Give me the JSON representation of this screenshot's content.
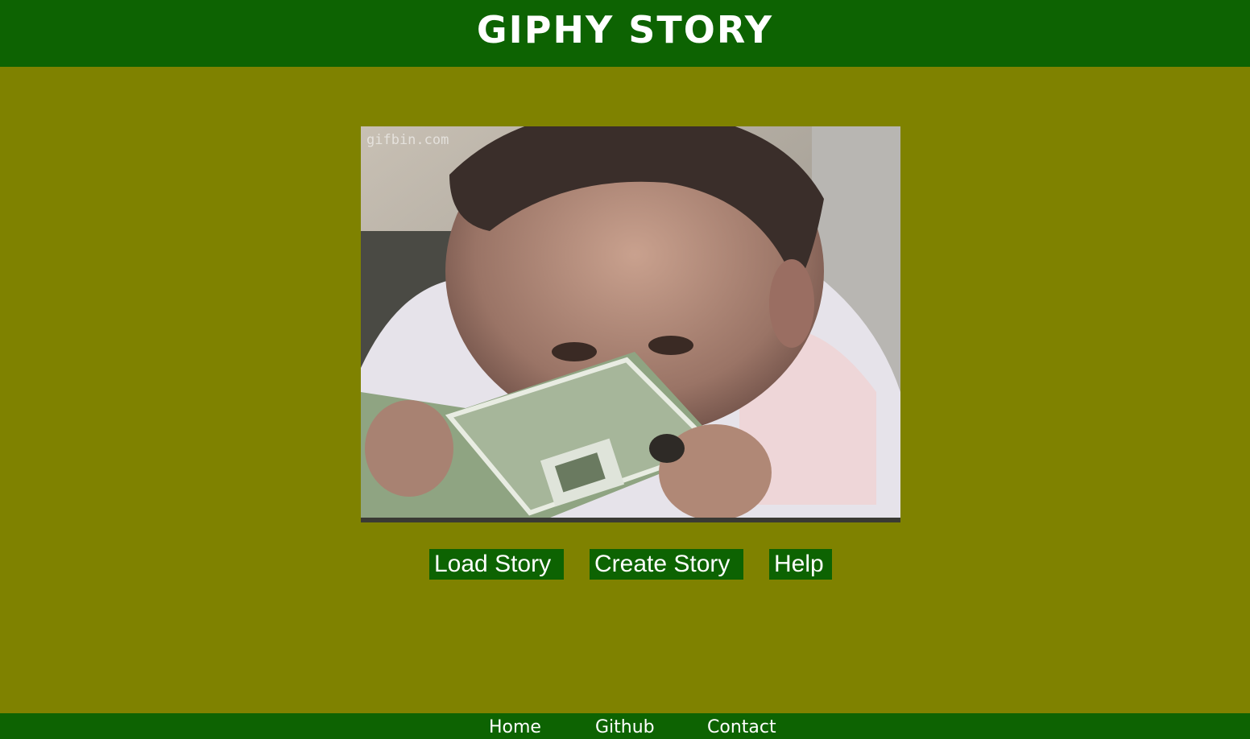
{
  "header": {
    "title": "GIPHY STORY"
  },
  "gif": {
    "watermark": "gifbin.com",
    "subject": "baby reading a picture book"
  },
  "actions": {
    "load_label": "Load Story",
    "create_label": "Create Story",
    "help_label": "Help"
  },
  "footer": {
    "links": [
      "Home",
      "Github",
      "Contact"
    ]
  },
  "colors": {
    "header_bg": "#0d6302",
    "page_bg": "#7f8200",
    "button_bg": "#0d6302",
    "text": "#ffffff"
  }
}
